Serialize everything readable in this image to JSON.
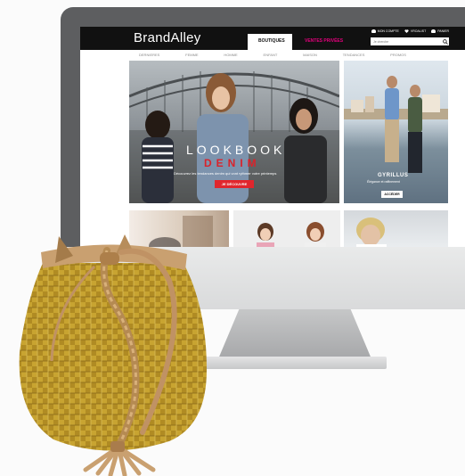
{
  "site": {
    "logo": "BrandAlley",
    "tabs": {
      "boutiques": "BOUTIQUES",
      "ventes": "VENTES PRIVÉES"
    },
    "util": {
      "account": "MON COMPTE",
      "wishlist": "VROALIST",
      "basket": "PANIER"
    },
    "search_placeholder": "Je cherche",
    "subnav": [
      "DERNIERES",
      "FEMME",
      "HOMME",
      "ENFANT",
      "MAISON",
      "TENDANCES",
      "PROMOS"
    ],
    "hero": {
      "title": "LOOKBOOK",
      "denim": "DENIM",
      "subtitle": "Découvrez les tendances denim qui vont rythmer votre printemps",
      "button": "JE DÉCOUVRE"
    },
    "side": {
      "title": "GYRILLUS",
      "subtitle": "Élégance et raffinement",
      "button": "ACCÉDER"
    }
  },
  "colors": {
    "accent_pink": "#e6007e",
    "accent_red": "#e0262d",
    "monitor_frame": "#5d5e60",
    "bag_yellow": "#c8a431",
    "bag_tan": "#c9a070"
  },
  "icons": [
    "account-icon",
    "heart-icon",
    "basket-icon",
    "search-icon"
  ]
}
